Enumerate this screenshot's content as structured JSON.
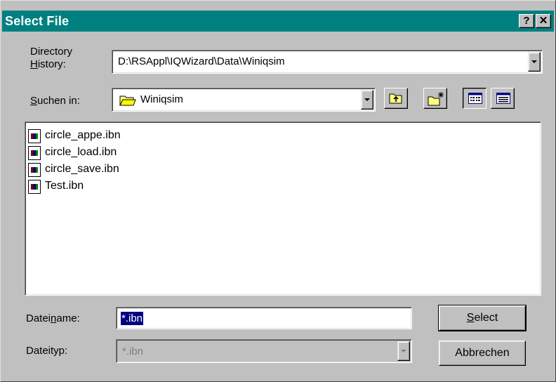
{
  "window": {
    "title": "Select File",
    "help_label": "?",
    "close_label": "✕"
  },
  "directory_history": {
    "label_line1": "Directory",
    "label_line2_ul": "H",
    "label_line2_rest": "istory:",
    "value": "D:\\RSAppl\\IQWizard\\Data\\Winiqsim"
  },
  "look_in": {
    "label_ul": "S",
    "label_rest": "uchen in:",
    "value": "Winiqsim",
    "icon": "folder-icon"
  },
  "toolbar": {
    "buttons": [
      {
        "name": "up-one-level-button",
        "icon": "up-folder-icon"
      },
      {
        "name": "new-folder-button",
        "icon": "new-folder-icon"
      },
      {
        "name": "list-view-button",
        "icon": "list-view-icon",
        "pressed": true
      },
      {
        "name": "details-view-button",
        "icon": "details-view-icon",
        "pressed": false
      }
    ]
  },
  "files": [
    {
      "name": "circle_appe.ibn"
    },
    {
      "name": "circle_load.ibn"
    },
    {
      "name": "circle_save.ibn"
    },
    {
      "name": "Test.ibn"
    }
  ],
  "file_name": {
    "label_pre": "Datei",
    "label_ul": "n",
    "label_post": "ame:",
    "value": "*.ibn"
  },
  "file_type": {
    "label": "Dateityp:",
    "value": "*.ibn"
  },
  "buttons": {
    "select_ul": "S",
    "select_rest": "elect",
    "cancel": "Abbrechen"
  },
  "colors": {
    "titlebar": "#008080",
    "face": "#c0c0c0",
    "selection": "#000080"
  }
}
